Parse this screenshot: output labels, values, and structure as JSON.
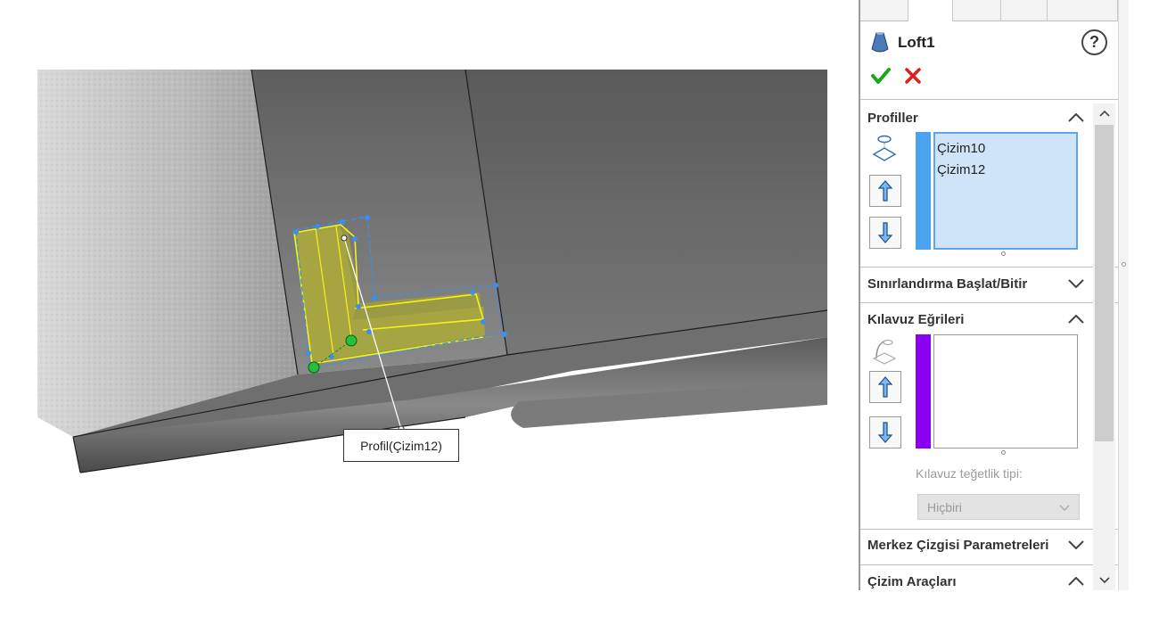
{
  "viewport": {
    "callout_text": "Profil(Çizim12)"
  },
  "property_manager": {
    "feature_name": "Loft1",
    "help_label": "?",
    "ok_icon": "check-icon",
    "cancel_icon": "x-icon",
    "sections": {
      "profiles": {
        "title": "Profiller",
        "items": [
          "Çizim10",
          "Çizim12"
        ],
        "bar_color": "#4ba3f0"
      },
      "start_end_constraints": {
        "title": "Sınırlandırma Başlat/Bitir"
      },
      "guide_curves": {
        "title": "Kılavuz Eğrileri",
        "items": [],
        "bar_color": "#8a00f0",
        "tangency_label": "Kılavuz teğetlik tipi:",
        "tangency_value": "Hiçbiri"
      },
      "centerline_params": {
        "title": "Merkez Çizgisi Parametreleri"
      },
      "sketch_tools": {
        "title": "Çizim Araçları"
      }
    }
  },
  "colors": {
    "accent_blue": "#4ba3f0",
    "guide_purple": "#8a00f0",
    "ok_green": "#1aa51a",
    "cancel_red": "#e21b1b",
    "profile_fill": "#9f9f3a"
  }
}
